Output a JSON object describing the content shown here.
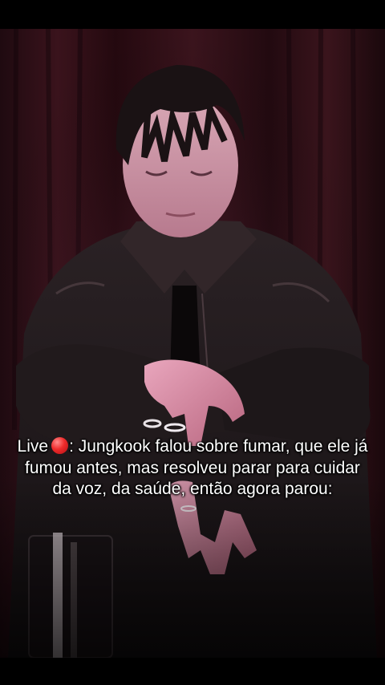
{
  "caption": {
    "prefix": "Live",
    "live_icon": "red-circle-icon",
    "text": ": Jungkook falou sobre fumar, que ele já fumou antes, mas resolveu parar para cuidar da voz, da saúde, então agora parou:"
  },
  "colors": {
    "background": "#000000",
    "curtain": "#2a0f17",
    "jacket": "#1c1618",
    "caption_text": "#ffffff",
    "live_dot": "#e62a2a"
  }
}
